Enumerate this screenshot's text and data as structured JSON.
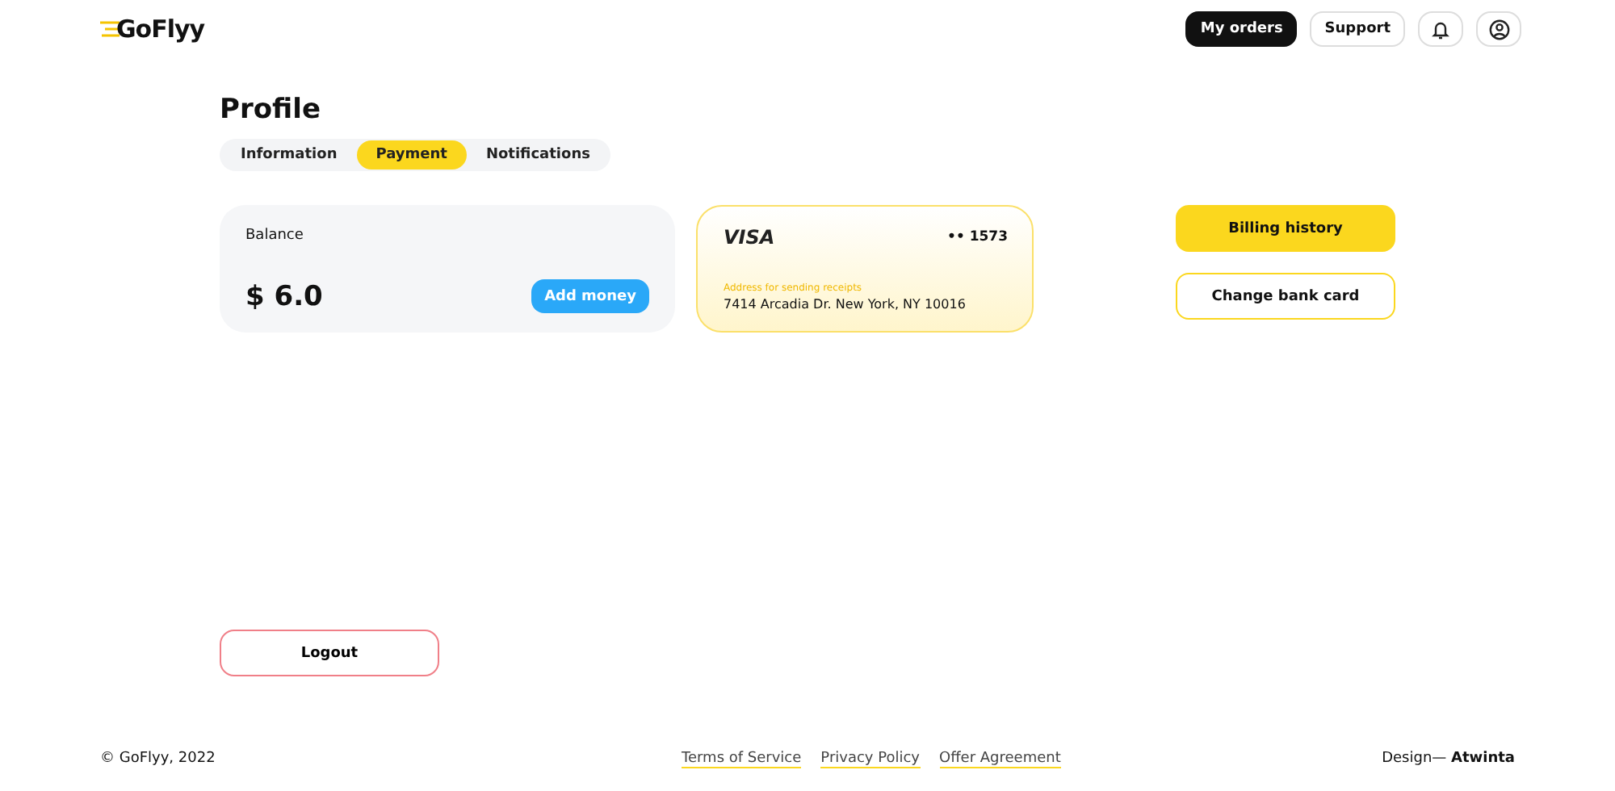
{
  "header": {
    "logo": "GoFlyy",
    "buttons": [
      {
        "label": "My orders",
        "selected": true
      },
      {
        "label": "Support",
        "selected": false
      }
    ]
  },
  "page": {
    "title": "Profile"
  },
  "tabs": [
    {
      "label": "Information",
      "selected": false
    },
    {
      "label": "Payment",
      "selected": true
    },
    {
      "label": "Notifications",
      "selected": false
    }
  ],
  "balance": {
    "label": "Balance",
    "amount": "$ 6.0",
    "button": "Add money"
  },
  "card": {
    "brand": "VISA",
    "number": "•• 1573",
    "address_label": "Address for sending receipts",
    "address": "7414 Arcadia Dr. New York, NY 10016"
  },
  "actions": [
    {
      "label": "Billing history",
      "kind": "primary"
    },
    {
      "label": "Change bank card",
      "kind": "outline"
    }
  ],
  "logout": "Logout",
  "footer": {
    "copyright": "© GoFlyy, 2022",
    "links": [
      "Terms of Service",
      "Privacy Policy",
      "Offer Agreement"
    ],
    "credit": "Design— **Atwinta**"
  }
}
